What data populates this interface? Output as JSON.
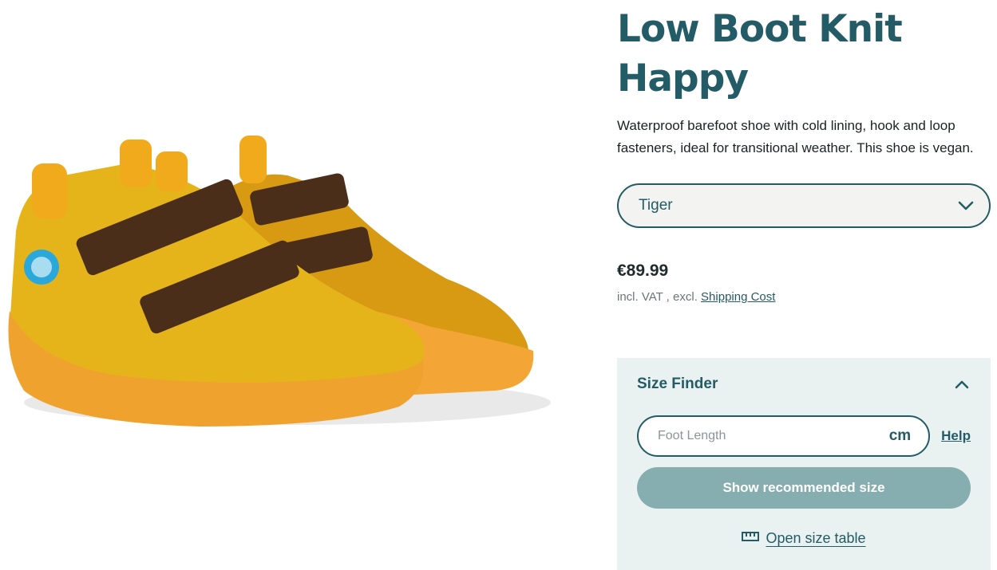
{
  "product": {
    "title_line1": "Low Boot Knit",
    "title_line2": "Happy",
    "description": "Waterproof barefoot shoe with cold lining, hook and loop fasteners, ideal for transitional weather. This shoe is vegan."
  },
  "variant": {
    "selected": "Tiger"
  },
  "pricing": {
    "price": "€89.99",
    "note_prefix": "incl. VAT , excl.",
    "shipping_link": "Shipping Cost"
  },
  "size_finder": {
    "title": "Size Finder",
    "foot_length_placeholder": "Foot Length",
    "unit": "cm",
    "help": "Help",
    "recommend_button": "Show recommended size",
    "size_table_link": "Open size table"
  },
  "colors": {
    "brand_teal": "#235c66",
    "panel_bg": "#e9f2f1",
    "button_muted": "#86adb0",
    "shoe_yellow": "#e8a813",
    "strap_brown": "#4a2e1a"
  },
  "icons": {
    "select_arrow": "chevron-down-icon",
    "collapse_arrow": "chevron-up-icon",
    "ruler": "ruler-icon"
  }
}
